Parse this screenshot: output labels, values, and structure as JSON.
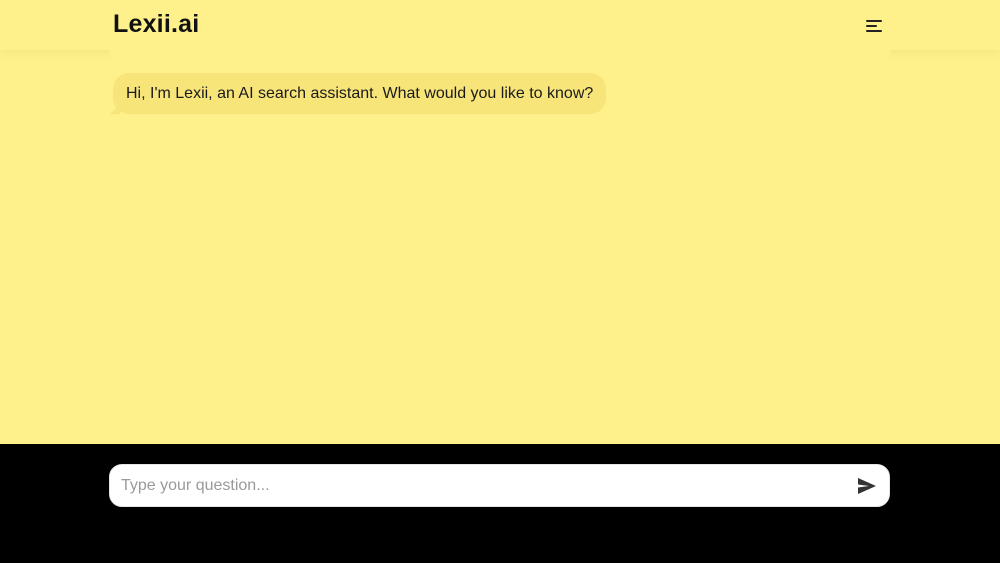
{
  "header": {
    "logo": "Lexii.ai",
    "menu_icon": "hamburger-menu-icon"
  },
  "chat": {
    "messages": [
      {
        "role": "assistant",
        "text": "Hi, I'm Lexii, an AI search assistant. What would you like to know?"
      }
    ]
  },
  "composer": {
    "placeholder": "Type your question...",
    "value": "",
    "send_icon": "send-icon"
  },
  "colors": {
    "background": "#FEF08A",
    "bubble": "#F8E57A",
    "footer": "#000000",
    "input": "#FFFFFF"
  }
}
